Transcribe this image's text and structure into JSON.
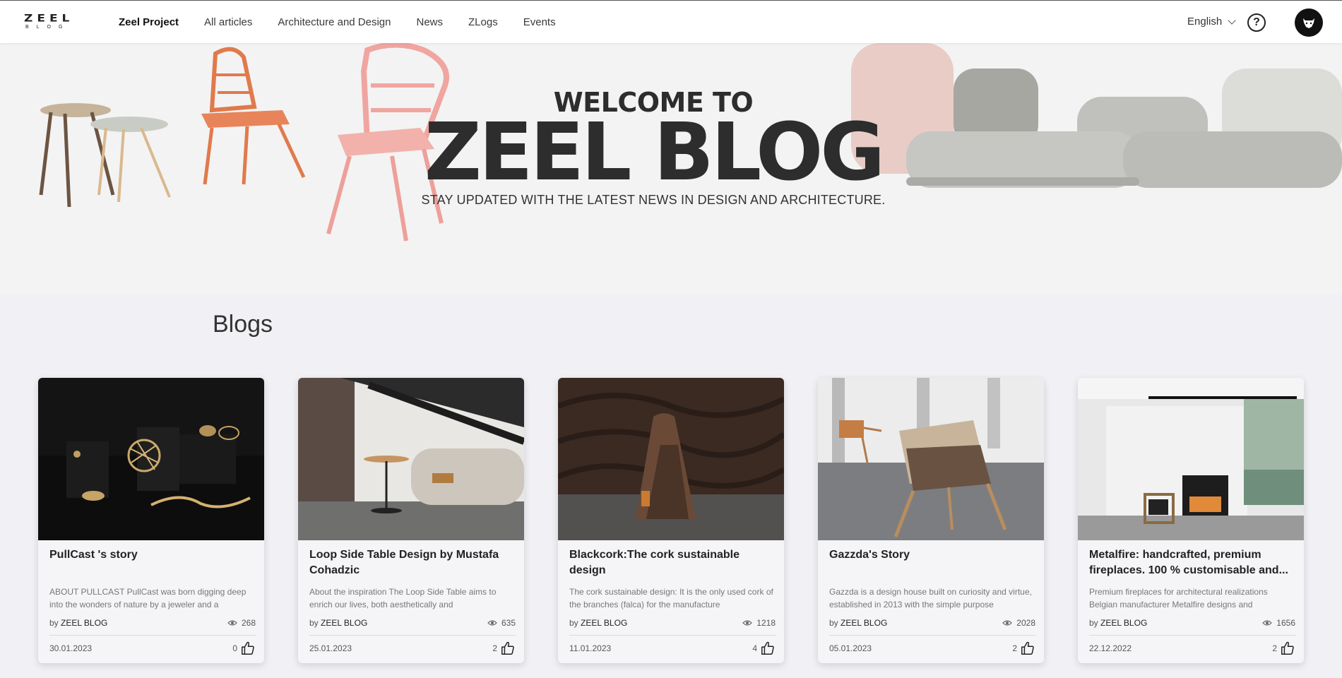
{
  "header": {
    "logo_word": "ZEEL",
    "logo_sub": "BLOG",
    "nav": [
      {
        "label": "Zeel Project",
        "active": true
      },
      {
        "label": "All articles"
      },
      {
        "label": "Architecture and Design"
      },
      {
        "label": "News"
      },
      {
        "label": "ZLogs"
      },
      {
        "label": "Events"
      }
    ],
    "language": "English",
    "help": "?"
  },
  "hero": {
    "line1": "WELCOME TO",
    "line2": "ZEEL BLOG",
    "subtitle": "STAY UPDATED WITH THE LATEST NEWS IN DESIGN AND ARCHITECTURE."
  },
  "section": {
    "title": "Blogs"
  },
  "cards": [
    {
      "title": "PullCast 's story",
      "excerpt": "ABOUT PULLCAST PullCast was born digging deep into the wonders of nature by a jeweler and a",
      "by": "by",
      "author": "ZEEL BLOG",
      "views": "268",
      "date": "30.01.2023",
      "likes": "0"
    },
    {
      "title": "Loop Side Table Design by Mustafa Cohadzic",
      "excerpt": "About the inspiration The Loop Side Table aims to enrich our lives, both aesthetically and",
      "by": "by",
      "author": "ZEEL BLOG",
      "views": "635",
      "date": "25.01.2023",
      "likes": "2"
    },
    {
      "title": "Blackcork:The cork sustainable design",
      "excerpt": "The cork sustainable design: It is the only used cork of the branches (falca) for the manufacture",
      "by": "by",
      "author": "ZEEL BLOG",
      "views": "1218",
      "date": "11.01.2023",
      "likes": "4"
    },
    {
      "title": "Gazzda's Story",
      "excerpt": "Gazzda is a design house built on curiosity and virtue, established in 2013 with the simple purpose",
      "by": "by",
      "author": "ZEEL BLOG",
      "views": "2028",
      "date": "05.01.2023",
      "likes": "2"
    },
    {
      "title": "Metalfire: handcrafted, premium fireplaces. 100 % customisable and...",
      "excerpt": "Premium fireplaces for architectural realizations Belgian manufacturer Metalfire designs and",
      "by": "by",
      "author": "ZEEL BLOG",
      "views": "1656",
      "date": "22.12.2022",
      "likes": "2"
    }
  ]
}
